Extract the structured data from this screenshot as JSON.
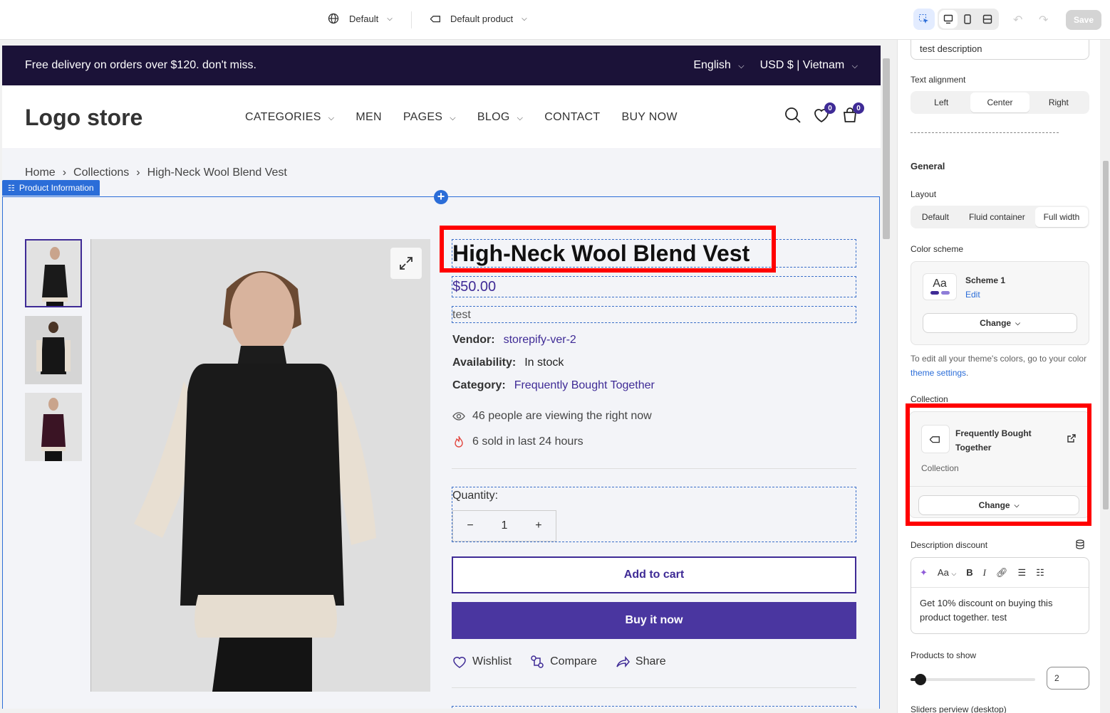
{
  "topbar": {
    "theme_select": "Default",
    "template_select": "Default product",
    "save_label": "Save"
  },
  "announcement": {
    "message": "Free delivery on orders over $120. don't miss.",
    "language": "English",
    "currency": "USD $ | Vietnam"
  },
  "header": {
    "logo": "Logo store",
    "nav": [
      "CATEGORIES",
      "MEN",
      "PAGES",
      "BLOG",
      "CONTACT",
      "BUY NOW"
    ],
    "wishlist_count": "0",
    "cart_count": "0"
  },
  "breadcrumb": [
    "Home",
    "Collections",
    "High-Neck Wool Blend Vest"
  ],
  "section_tag": "Product Information",
  "product": {
    "title": "High-Neck Wool Blend Vest",
    "price": "$50.00",
    "description": "test",
    "vendor_label": "Vendor:",
    "vendor": "storepify-ver-2",
    "availability_label": "Availability:",
    "availability": "In stock",
    "category_label": "Category:",
    "category": "Frequently Bought Together",
    "viewing": "46 people are viewing the right now",
    "sold": "6 sold in last 24 hours",
    "quantity_label": "Quantity:",
    "quantity": "1",
    "add_to_cart": "Add to cart",
    "buy_now": "Buy it now",
    "wishlist": "Wishlist",
    "compare": "Compare",
    "share": "Share"
  },
  "panel": {
    "desc_value": "test description",
    "text_alignment_label": "Text alignment",
    "alignment_options": [
      "Left",
      "Center",
      "Right"
    ],
    "alignment_selected": "Center",
    "general_heading": "General",
    "layout_label": "Layout",
    "layout_options": [
      "Default",
      "Fluid container",
      "Full width"
    ],
    "layout_selected": "Full width",
    "color_scheme_label": "Color scheme",
    "scheme_swatch": "Aa",
    "scheme_name": "Scheme 1",
    "scheme_edit": "Edit",
    "change_label": "Change",
    "color_note_prefix": "To edit all your theme's colors, go to your color ",
    "color_note_link": "theme settings",
    "color_note_suffix": ".",
    "collection_label": "Collection",
    "collection_name_line1": "Frequently Bought",
    "collection_name_line2": "Together",
    "collection_type": "Collection",
    "desc_discount_label": "Description discount",
    "rte_font": "Aa",
    "desc_discount_line1": "Get 10% discount on buying this",
    "desc_discount_line2": "product together. test",
    "products_to_show_label": "Products to show",
    "products_to_show": "2",
    "slider_preview_label": "Sliders perview (desktop)"
  },
  "colors": {
    "brand_purple": "#3f2b96",
    "announcement_bg": "#1b1238",
    "editor_blue": "#2b6dd8",
    "highlight_red": "#ff0000"
  }
}
